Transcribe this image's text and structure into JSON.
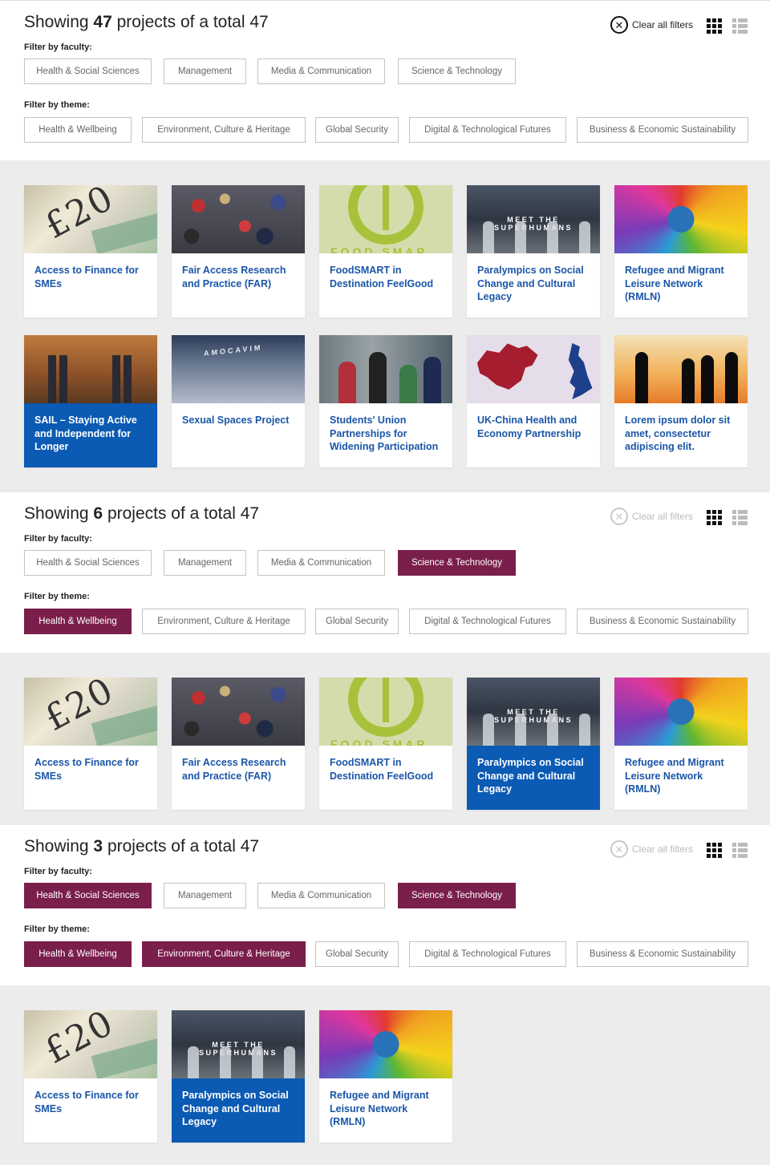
{
  "colors": {
    "accent": "#7a1e4b",
    "link": "#1a56a8",
    "highlight": "#0b5ab3"
  },
  "icons": {
    "clear": "close-circle-icon",
    "grid_view": "grid-view-icon",
    "list_view": "list-view-icon"
  },
  "common": {
    "heading_prefix": "Showing",
    "heading_middle": "projects of a total",
    "total": "47",
    "clear_label": "Clear all filters",
    "faculty_label": "Filter by faculty:",
    "theme_label": "Filter by theme:",
    "faculties": [
      "Health & Social Sciences",
      "Management",
      "Media & Communication",
      "Science & Technology"
    ],
    "themes": [
      "Health & Wellbeing",
      "Environment, Culture & Heritage",
      "Global Security",
      "Digital & Technological Futures",
      "Business & Economic Sustainability"
    ]
  },
  "panels": [
    {
      "count": "47",
      "clear_enabled": true,
      "active_faculties": [],
      "active_themes": []
    },
    {
      "count": "6",
      "clear_enabled": false,
      "active_faculties": [
        "Science & Technology"
      ],
      "active_themes": [
        "Health & Wellbeing"
      ]
    },
    {
      "count": "3",
      "clear_enabled": false,
      "active_faculties": [
        "Health & Social Sciences",
        "Science & Technology"
      ],
      "active_themes": [
        "Health & Wellbeing",
        "Environment, Culture & Heritage"
      ]
    }
  ],
  "projects": {
    "access_finance": "Access to Finance for SMEs",
    "fair_access": "Fair Access Research and Practice (FAR)",
    "foodsmart": "FoodSMART in Destination FeelGood",
    "paralympics": "Paralympics on Social Change and Cultural Legacy",
    "refugee": "Refugee and Migrant Leisure Network (RMLN)",
    "sail": "SAIL – Staying Active and Independent for Longer",
    "sexual_spaces": "Sexual Spaces Project",
    "students_union": "Students' Union Partnerships for Widening Participation",
    "uk_china": "UK-China Health and Economy Partnership",
    "lorem": "Lorem ipsum dolor sit amet, consectetur adipiscing elit."
  },
  "thumb_text": {
    "superhumans": "MEET THE SUPERHUMANS",
    "money": "£20",
    "food": "FOOD SMAR",
    "sexual": "AMOCAVIM"
  }
}
